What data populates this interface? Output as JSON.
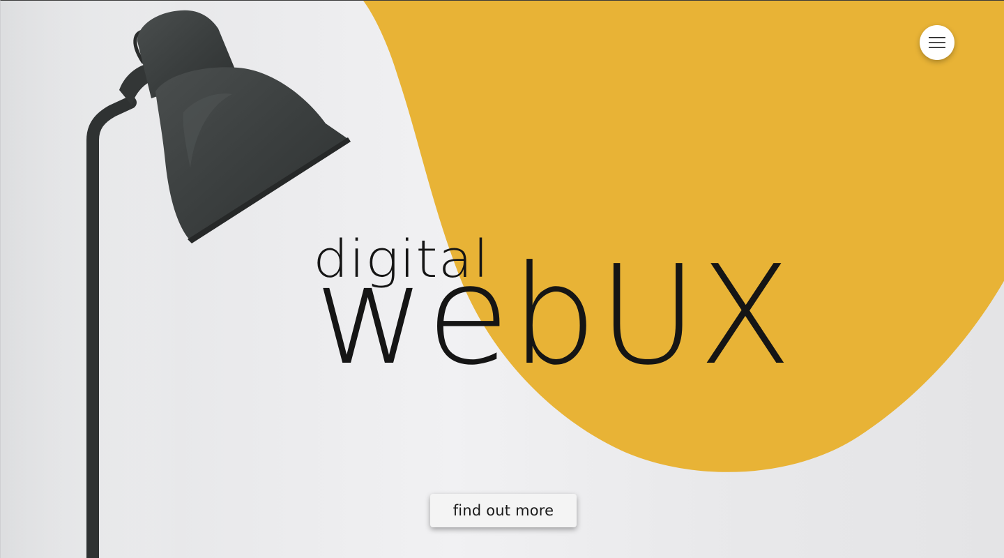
{
  "hero": {
    "brand_small": "digital",
    "brand_large": "webUX",
    "cta_label": "find out more"
  },
  "colors": {
    "accent_yellow": "#E8B336",
    "background": "#ECECEE",
    "lamp": "#3A3D3D",
    "text": "#151515"
  },
  "icons": {
    "menu": "hamburger-icon"
  }
}
